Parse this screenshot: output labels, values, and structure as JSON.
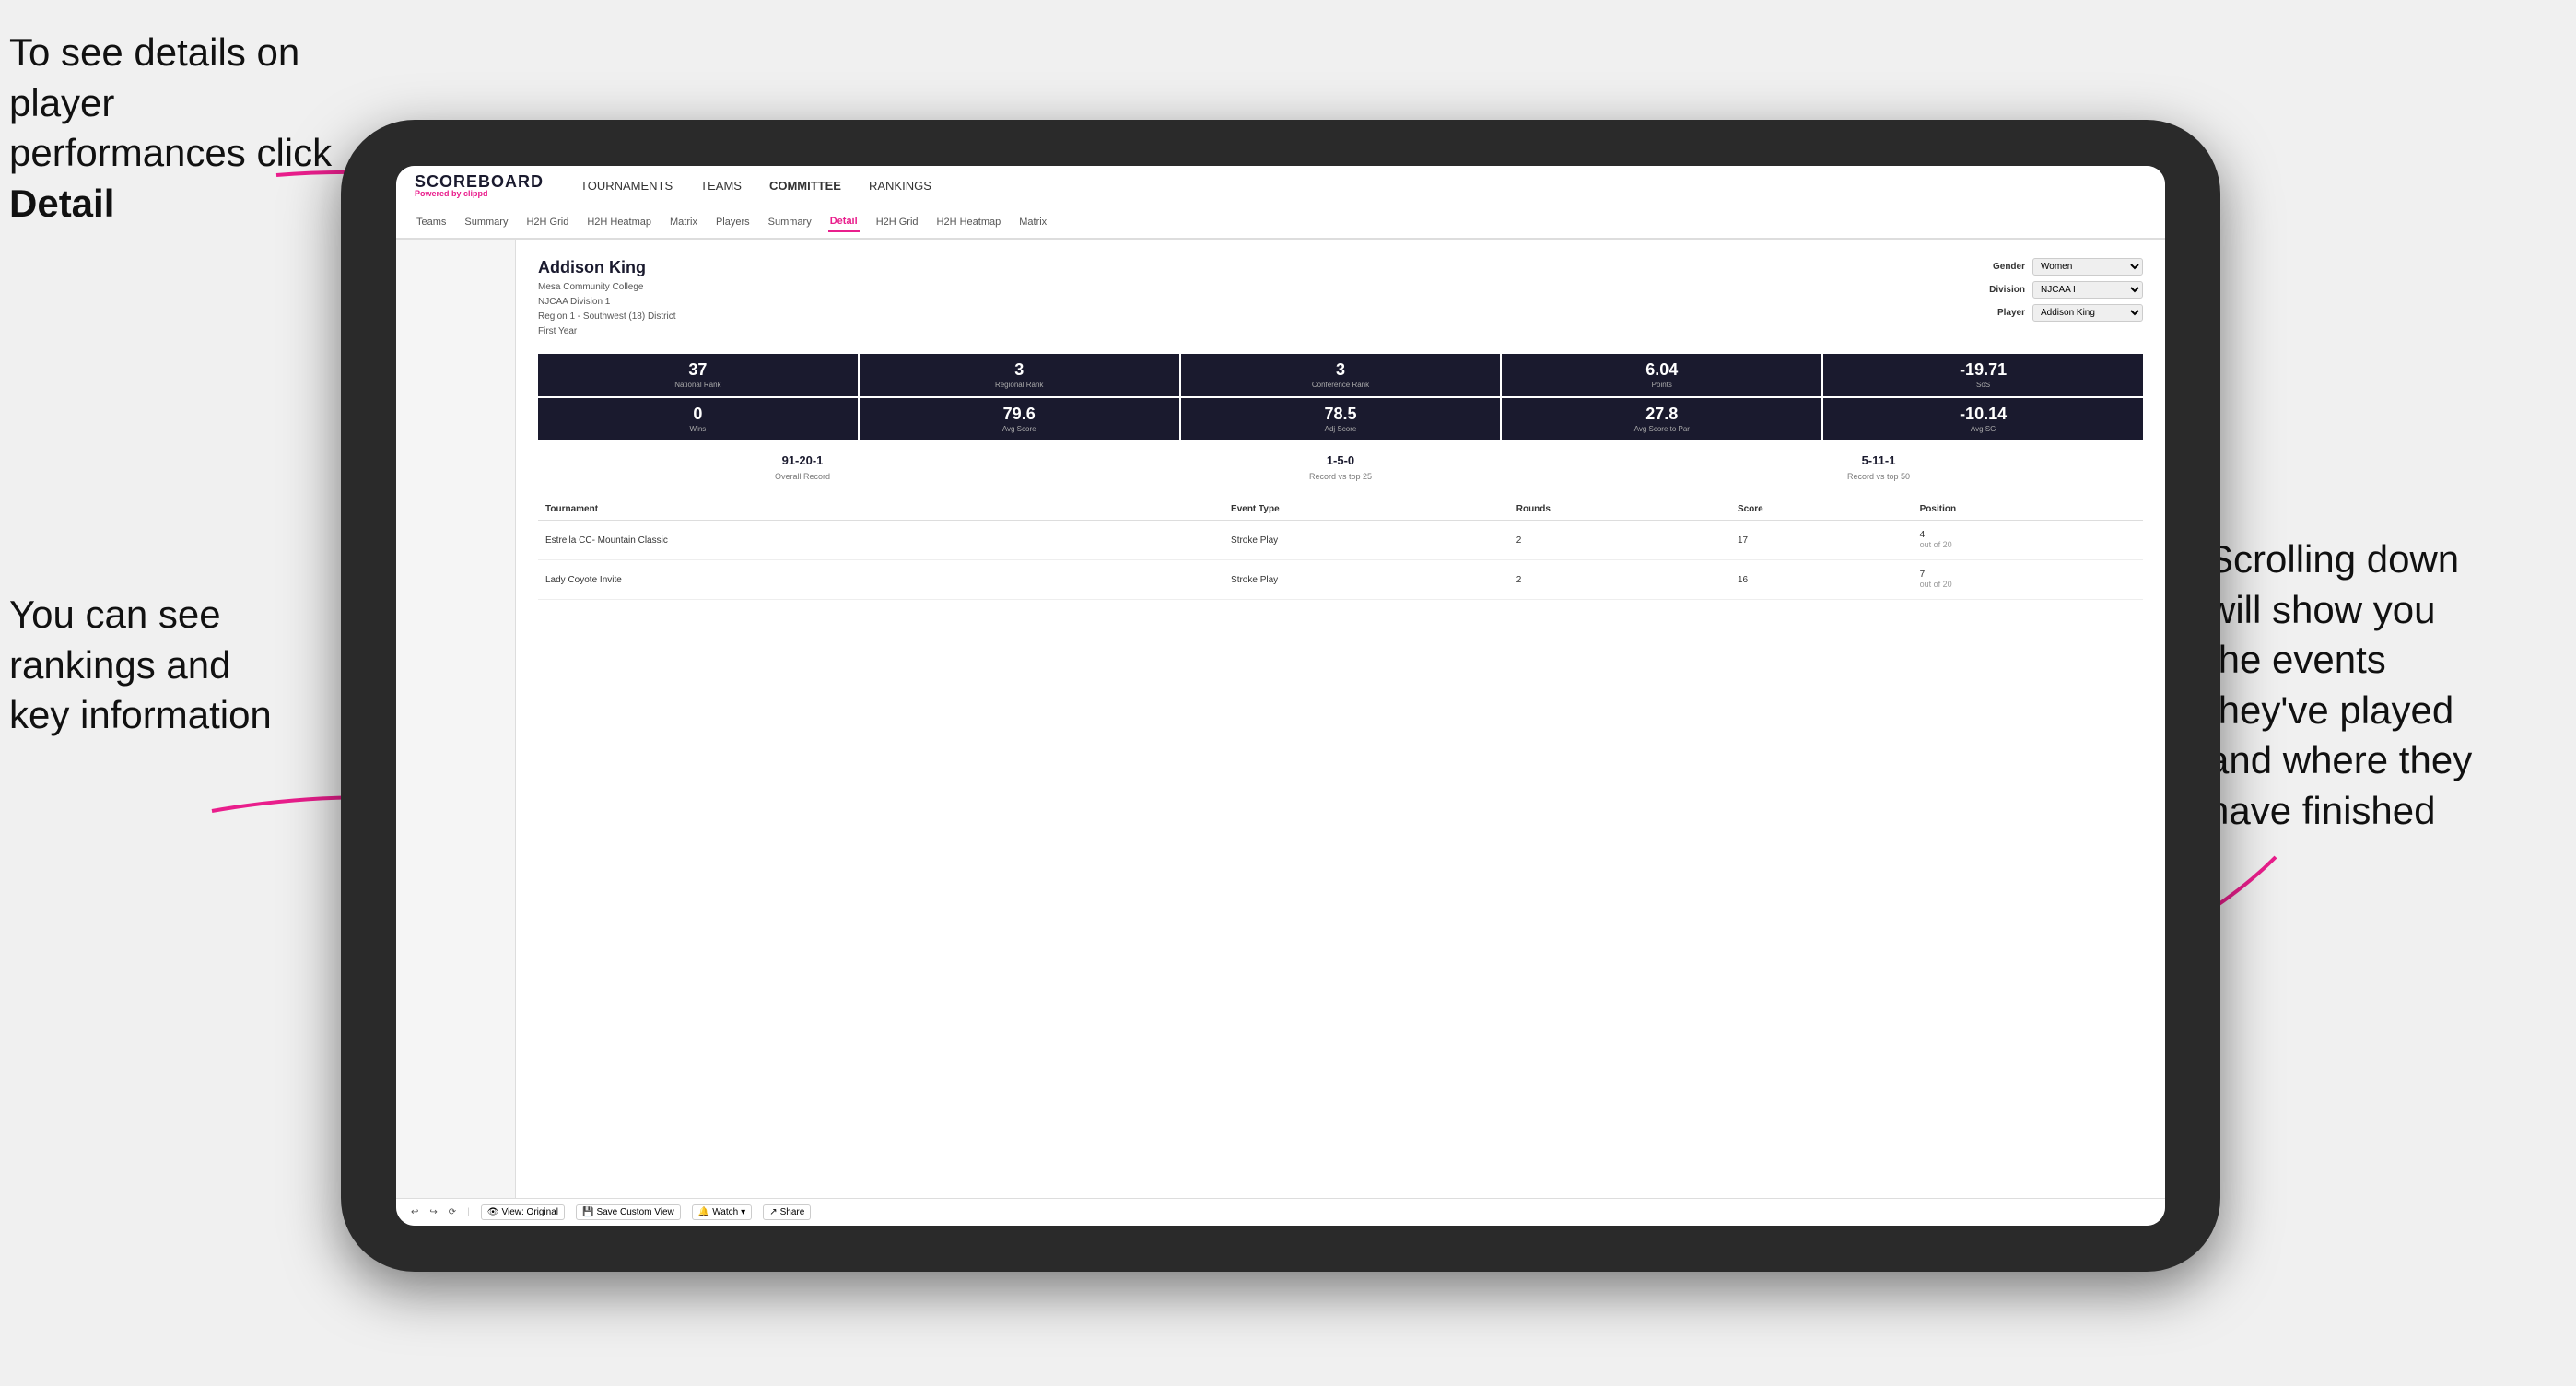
{
  "annotations": {
    "top_left": "To see details on player performances click",
    "top_left_bold": "Detail",
    "bottom_left_line1": "You can see",
    "bottom_left_line2": "rankings and",
    "bottom_left_line3": "key information",
    "right_line1": "Scrolling down",
    "right_line2": "will show you",
    "right_line3": "the events",
    "right_line4": "they've played",
    "right_line5": "and where they",
    "right_line6": "have finished"
  },
  "app": {
    "logo_title": "SCOREBOARD",
    "logo_powered": "Powered by",
    "logo_brand": "clippd",
    "nav": [
      {
        "label": "TOURNAMENTS",
        "active": false
      },
      {
        "label": "TEAMS",
        "active": false
      },
      {
        "label": "COMMITTEE",
        "active": false
      },
      {
        "label": "RANKINGS",
        "active": false
      }
    ],
    "subnav": [
      {
        "label": "Teams",
        "active": false
      },
      {
        "label": "Summary",
        "active": false
      },
      {
        "label": "H2H Grid",
        "active": false
      },
      {
        "label": "H2H Heatmap",
        "active": false
      },
      {
        "label": "Matrix",
        "active": false
      },
      {
        "label": "Players",
        "active": false
      },
      {
        "label": "Summary",
        "active": false
      },
      {
        "label": "Detail",
        "active": true
      },
      {
        "label": "H2H Grid",
        "active": false
      },
      {
        "label": "H2H Heatmap",
        "active": false
      },
      {
        "label": "Matrix",
        "active": false
      }
    ]
  },
  "player": {
    "name": "Addison King",
    "college": "Mesa Community College",
    "division": "NJCAA Division 1",
    "region": "Region 1 - Southwest (18) District",
    "year": "First Year",
    "gender_label": "Gender",
    "gender_value": "Women",
    "division_label": "Division",
    "division_value": "NJCAA I",
    "player_label": "Player",
    "player_value": "Addison King"
  },
  "stats_row1": [
    {
      "value": "37",
      "label": "National Rank"
    },
    {
      "value": "3",
      "label": "Regional Rank"
    },
    {
      "value": "3",
      "label": "Conference Rank"
    },
    {
      "value": "6.04",
      "label": "Points"
    },
    {
      "value": "-19.71",
      "label": "SoS"
    }
  ],
  "stats_row2": [
    {
      "value": "0",
      "label": "Wins"
    },
    {
      "value": "79.6",
      "label": "Avg Score"
    },
    {
      "value": "78.5",
      "label": "Adj Score"
    },
    {
      "value": "27.8",
      "label": "Avg Score to Par"
    },
    {
      "value": "-10.14",
      "label": "Avg SG"
    }
  ],
  "records": [
    {
      "value": "91-20-1",
      "label": "Overall Record"
    },
    {
      "value": "1-5-0",
      "label": "Record vs top 25"
    },
    {
      "value": "5-11-1",
      "label": "Record vs top 50"
    }
  ],
  "table": {
    "headers": [
      "Tournament",
      "",
      "Event Type",
      "Rounds",
      "Score",
      "Position"
    ],
    "rows": [
      {
        "tournament": "Estrella CC- Mountain Classic",
        "event_type": "Stroke Play",
        "rounds": "2",
        "score": "17",
        "position": "4",
        "position_detail": "out of 20"
      },
      {
        "tournament": "Lady Coyote Invite",
        "event_type": "Stroke Play",
        "rounds": "2",
        "score": "16",
        "position": "7",
        "position_detail": "out of 20"
      }
    ]
  },
  "toolbar": {
    "view_original": "View: Original",
    "save_custom": "Save Custom View",
    "watch": "Watch",
    "share": "Share"
  }
}
